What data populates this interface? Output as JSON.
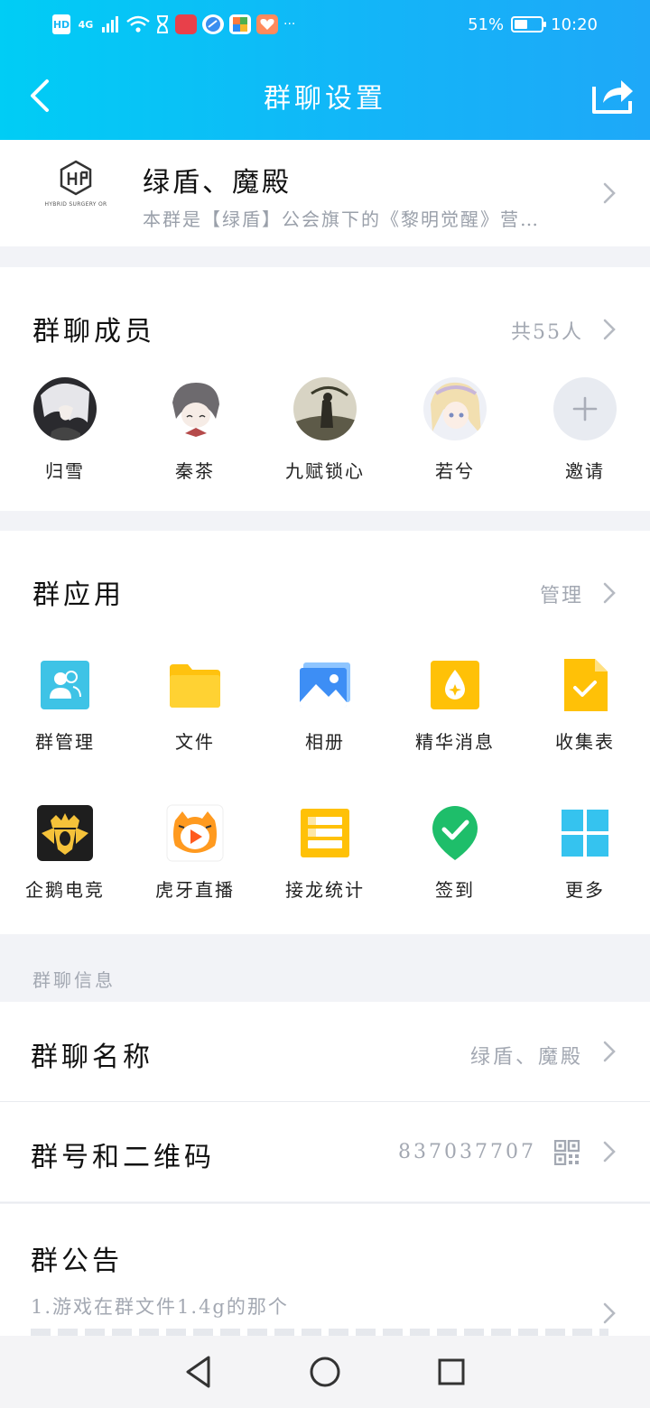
{
  "status_bar": {
    "hd": "HD",
    "network": "4G",
    "battery_percent": "51%",
    "battery_level": 0.51,
    "time": "10:20"
  },
  "nav": {
    "title": "群聊设置"
  },
  "group": {
    "logo_caption": "HYBRID SURGERY OR",
    "name": "绿盾、魔殿",
    "description": "本群是【绿盾】公会旗下的《黎明觉醒》营…"
  },
  "members": {
    "title": "群聊成员",
    "count": "共55人",
    "list": [
      {
        "name": "归雪"
      },
      {
        "name": "秦茶"
      },
      {
        "name": "九赋锁心"
      },
      {
        "name": "若兮"
      }
    ],
    "invite_label": "邀请"
  },
  "apps": {
    "title": "群应用",
    "manage": "管理",
    "items": [
      {
        "label": "群管理",
        "icon": "group-manage-icon"
      },
      {
        "label": "文件",
        "icon": "folder-icon"
      },
      {
        "label": "相册",
        "icon": "album-icon"
      },
      {
        "label": "精华消息",
        "icon": "essence-icon"
      },
      {
        "label": "收集表",
        "icon": "collect-form-icon"
      },
      {
        "label": "企鹅电竞",
        "icon": "penguin-esports-icon"
      },
      {
        "label": "虎牙直播",
        "icon": "huya-live-icon"
      },
      {
        "label": "接龙统计",
        "icon": "relay-stats-icon"
      },
      {
        "label": "签到",
        "icon": "check-in-icon"
      },
      {
        "label": "更多",
        "icon": "more-icon"
      }
    ]
  },
  "info": {
    "section_label": "群聊信息",
    "group_name_label": "群聊名称",
    "group_name_value": "绿盾、魔殿",
    "group_number_label": "群号和二维码",
    "group_number_value": "837037707",
    "notice_label": "群公告",
    "notice_line1": "1.游戏在群文件1.4g的那个"
  },
  "colors": {
    "header_start": "#00cdf5",
    "header_end": "#1ea8f8",
    "text_secondary": "#a3a8b2"
  }
}
